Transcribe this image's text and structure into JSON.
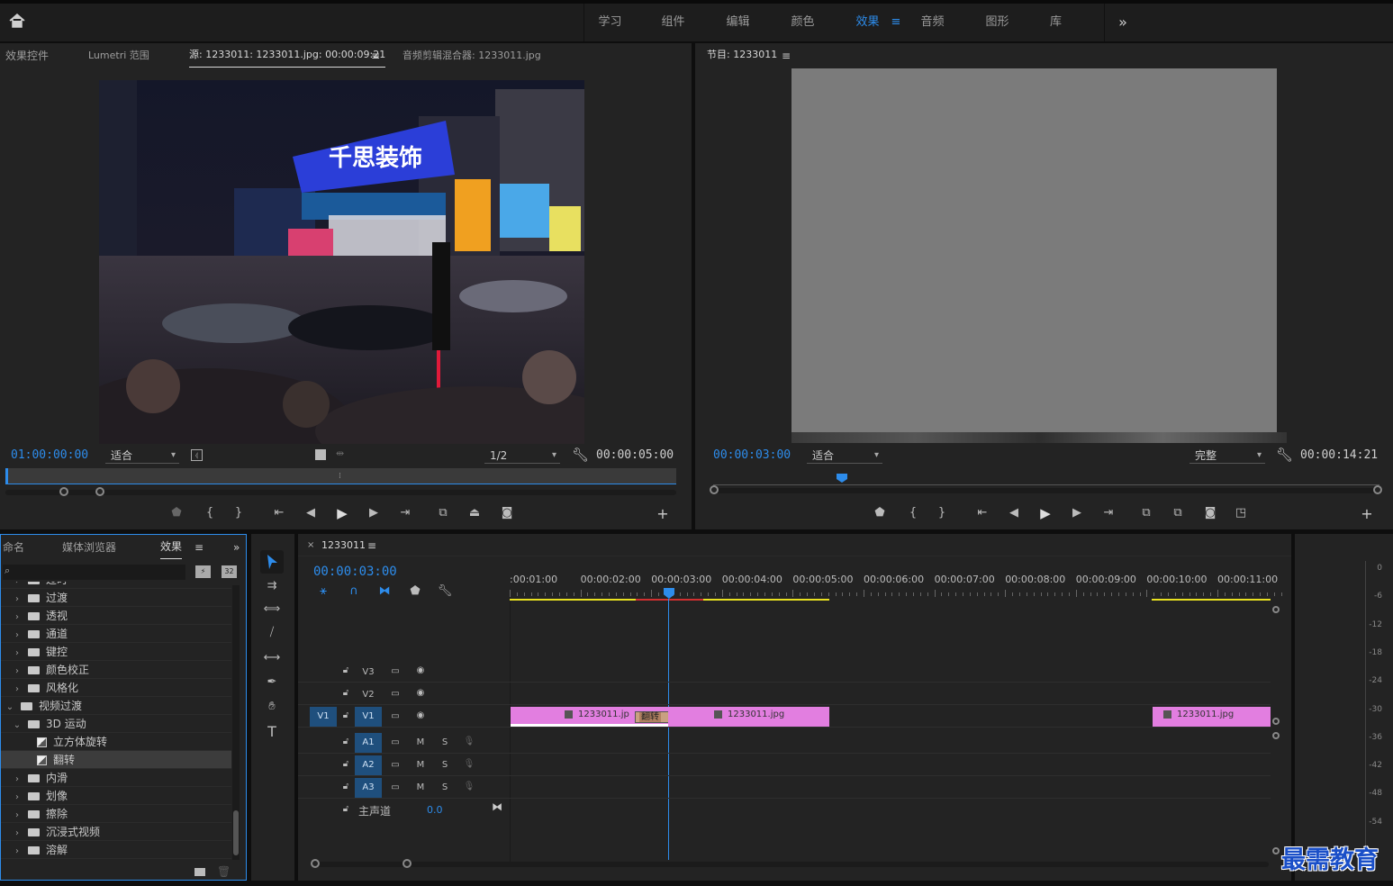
{
  "workspaces": [
    {
      "label": "学习",
      "active": false
    },
    {
      "label": "组件",
      "active": false
    },
    {
      "label": "编辑",
      "active": false
    },
    {
      "label": "颜色",
      "active": false
    },
    {
      "label": "效果",
      "active": true
    },
    {
      "label": "音频",
      "active": false
    },
    {
      "label": "图形",
      "active": false
    },
    {
      "label": "库",
      "active": false
    }
  ],
  "workspace_menu_icon": "≡",
  "more_icon": "»",
  "source_panel": {
    "tabs": [
      {
        "label": "效果控件",
        "active": false
      },
      {
        "label": "Lumetri 范围",
        "active": false
      },
      {
        "label": "源: 1233011: 1233011.jpg: 00:00:09:21",
        "active": true
      },
      {
        "label": "音频剪辑混合器: 1233011.jpg",
        "active": false
      }
    ],
    "timecode": "01:00:00:00",
    "fit": "适合",
    "resolution": "1/2",
    "duration": "00:00:05:00",
    "image_text": "千思装饰"
  },
  "program_panel": {
    "title": "节目: 1233011",
    "timecode": "00:00:03:00",
    "fit": "适合",
    "quality": "完整",
    "duration": "00:00:14:21"
  },
  "effects_panel": {
    "tabs": [
      {
        "label": "命名",
        "active": false
      },
      {
        "label": "媒体浏览器",
        "active": false
      },
      {
        "label": "效果",
        "active": true
      }
    ],
    "search_placeholder": "",
    "items": [
      {
        "label": "过时",
        "type": "folder",
        "indent": 0,
        "open": false
      },
      {
        "label": "过渡",
        "type": "folder",
        "indent": 0,
        "open": false
      },
      {
        "label": "透视",
        "type": "folder",
        "indent": 0,
        "open": false
      },
      {
        "label": "通道",
        "type": "folder",
        "indent": 0,
        "open": false
      },
      {
        "label": "键控",
        "type": "folder",
        "indent": 0,
        "open": false
      },
      {
        "label": "颜色校正",
        "type": "folder",
        "indent": 0,
        "open": false
      },
      {
        "label": "风格化",
        "type": "folder",
        "indent": 0,
        "open": false
      },
      {
        "label": "视频过渡",
        "type": "folder",
        "indent": -1,
        "open": true
      },
      {
        "label": "3D 运动",
        "type": "folder",
        "indent": 0,
        "open": true
      },
      {
        "label": "立方体旋转",
        "type": "effect",
        "indent": 1
      },
      {
        "label": "翻转",
        "type": "effect",
        "indent": 1,
        "selected": true
      },
      {
        "label": "内滑",
        "type": "folder",
        "indent": 0,
        "open": false
      },
      {
        "label": "划像",
        "type": "folder",
        "indent": 0,
        "open": false
      },
      {
        "label": "擦除",
        "type": "folder",
        "indent": 0,
        "open": false
      },
      {
        "label": "沉浸式视频",
        "type": "folder",
        "indent": 0,
        "open": false
      },
      {
        "label": "溶解",
        "type": "folder",
        "indent": 0,
        "open": false
      }
    ]
  },
  "timeline": {
    "close": "×",
    "sequence": "1233011",
    "timecode": "00:00:03:00",
    "ruler": [
      ":00:01:00",
      "00:00:02:00",
      "00:00:03:00",
      "00:00:04:00",
      "00:00:05:00",
      "00:00:06:00",
      "00:00:07:00",
      "00:00:08:00",
      "00:00:09:00",
      "00:00:10:00",
      "00:00:11:00"
    ],
    "video_tracks": [
      {
        "name": "V3",
        "source": ""
      },
      {
        "name": "V2",
        "source": ""
      },
      {
        "name": "V1",
        "source": "V1"
      }
    ],
    "audio_tracks": [
      "A1",
      "A2",
      "A3"
    ],
    "mute": "M",
    "solo": "S",
    "master_label": "主声道",
    "master_value": "0.0",
    "clips": [
      {
        "label": "1233011.jp"
      },
      {
        "label": "1233011.jpg"
      },
      {
        "label": "1233011.jpg"
      }
    ],
    "transition_label": "翻转"
  },
  "meter_labels": [
    "0",
    "-6",
    "-12",
    "-18",
    "-24",
    "-30",
    "-36",
    "-42",
    "-48",
    "-54"
  ],
  "watermark": "最需教育",
  "colors": {
    "accent": "#2d8ceb",
    "clip": "#e27ee0",
    "track_target": "#1f4f7d"
  }
}
